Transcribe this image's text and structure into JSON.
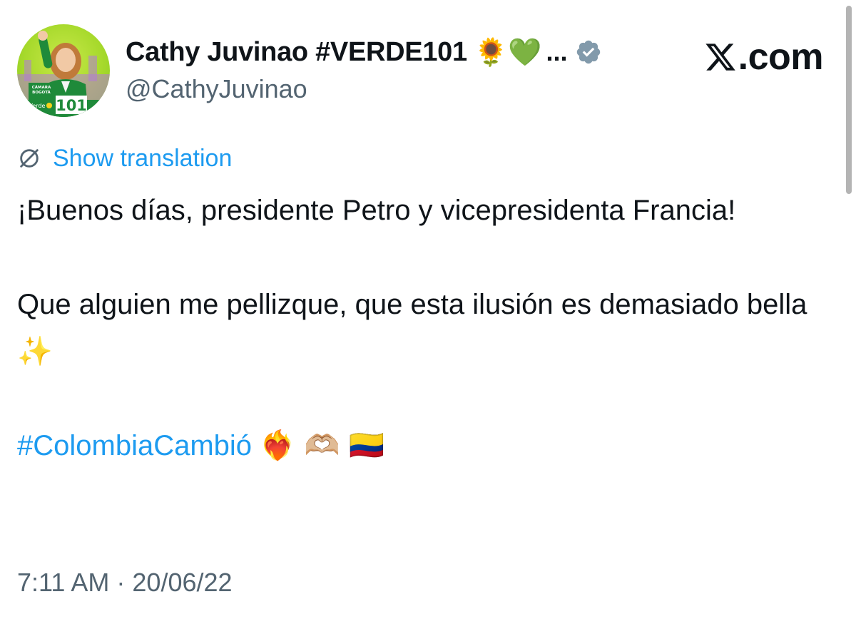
{
  "author": {
    "display_name": "Cathy Juvinao #VERDE101",
    "name_emojis": "🌻💚",
    "truncation": "...",
    "handle": "@CathyJuvinao",
    "verified": true,
    "avatar_lettering": {
      "camara": "CÁMARA",
      "city": "BOGOTÁ",
      "number": "101",
      "party": "Verde"
    }
  },
  "brand": {
    "label": ".com",
    "icon": "x-logo-icon"
  },
  "translation": {
    "label": "Show translation",
    "icon": "globe-icon"
  },
  "tweet": {
    "para1": "¡Buenos días, presidente Petro y vicepresidenta Francia!",
    "para2_text": "Que alguien me pellizque, que esta ilusión es demasiado bella",
    "para2_emoji": "✨",
    "hashtag": "#ColombiaCambió",
    "hashtag_emojis": "❤️‍🔥 🫶🏼 🇨🇴"
  },
  "timestamp": "7:11 AM · 20/06/22",
  "colors": {
    "link": "#1d9bf0",
    "muted": "#536471",
    "text": "#0f1419",
    "verified_badge": "#829aab"
  }
}
